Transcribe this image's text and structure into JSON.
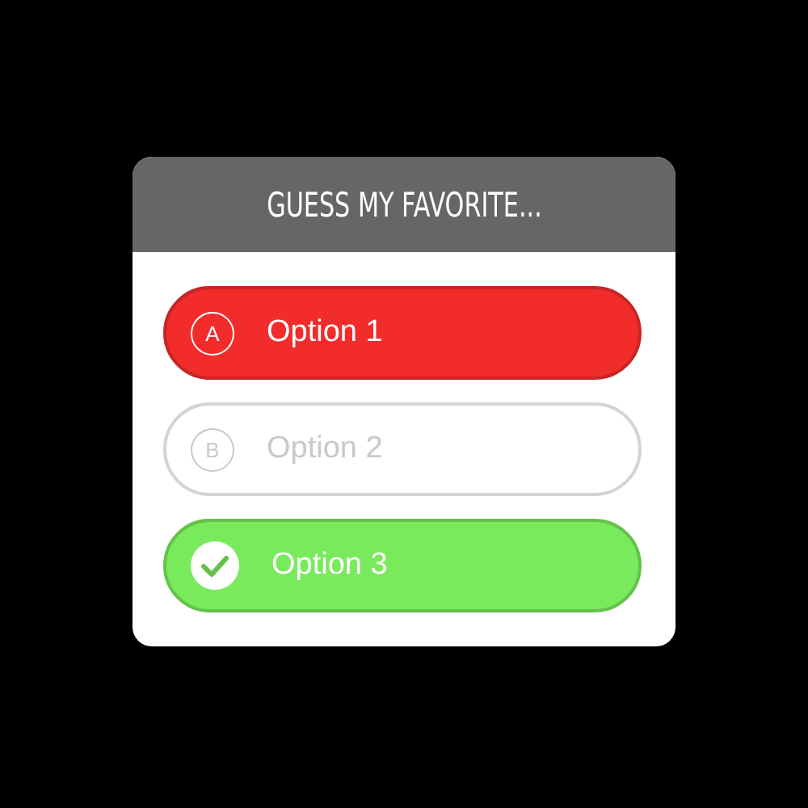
{
  "card": {
    "title": "GUESS MY FAVORITE..."
  },
  "options": [
    {
      "kind": "wrong",
      "letter": "A",
      "label": "Option 1"
    },
    {
      "kind": "dimmed",
      "letter": "B",
      "label": "Option 2"
    },
    {
      "kind": "correct",
      "label": "Option 3"
    }
  ]
}
